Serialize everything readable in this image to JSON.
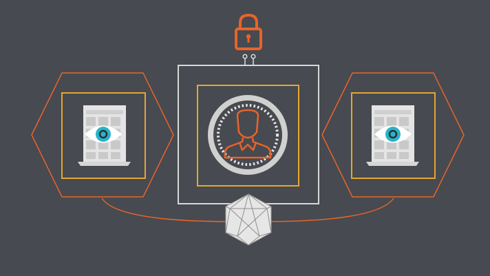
{
  "colors": {
    "background": "#474a50",
    "orange": "#e8642a",
    "gold": "#e6a72f",
    "frame": "#d8d8d8",
    "panel": "#e4e4e4",
    "panel_dark": "#c9c9c9",
    "eye_white": "#ffffff",
    "iris": "#2ab3c8",
    "pupil": "#2a2f36",
    "hub_fill": "#e6e6e6",
    "hub_stroke": "#9a9a9a"
  },
  "icons": {
    "lock": "lock-icon",
    "user": "user-icon",
    "eye": "eye-icon",
    "document": "document-icon",
    "hub": "star-polyhedron-icon"
  }
}
